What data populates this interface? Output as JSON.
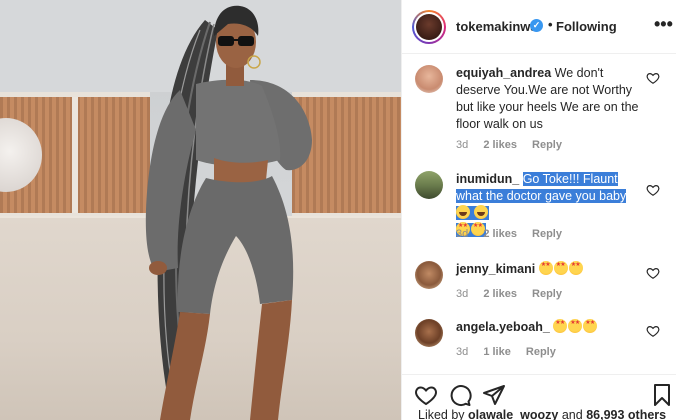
{
  "post": {
    "username": "tokemakinwa",
    "follow_label": "Following",
    "separator": "•",
    "verified_mark": "✓",
    "more_label": "•••"
  },
  "comments": [
    {
      "username": "equiyah_andrea",
      "text": "We don't deserve You.We are not Worthy but like your heels We are on the floor walk on us",
      "time": "3d",
      "likes": "2 likes",
      "reply": "Reply"
    },
    {
      "username": "inumidun_",
      "text_highlighted": "Go Toke!!! Flaunt what the doctor gave you baby",
      "time": "3d",
      "likes": "2 likes",
      "reply": "Reply",
      "emojis": [
        "laughing-emoji",
        "laughing-emoji",
        "star-struck-emoji",
        "star-struck-emoji"
      ]
    },
    {
      "username": "jenny_kimani",
      "time": "3d",
      "likes": "2 likes",
      "reply": "Reply",
      "emojis": [
        "star-struck-emoji",
        "star-struck-emoji",
        "star-struck-emoji"
      ]
    },
    {
      "username": "angela.yeboah_",
      "time": "3d",
      "likes": "1 like",
      "reply": "Reply",
      "emojis": [
        "star-struck-emoji",
        "star-struck-emoji",
        "star-struck-emoji"
      ]
    }
  ],
  "actions": {
    "icons": [
      "heart-icon",
      "comment-icon",
      "share-icon",
      "bookmark-icon"
    ]
  },
  "liked_by": {
    "prefix": "Liked by",
    "user": "olawale_woozy",
    "connector": "and",
    "others": "86,993 others"
  },
  "colors": {
    "highlight": "#3b7ed9",
    "verified": "#3897f0",
    "meta_gray": "#8e8e8e"
  }
}
